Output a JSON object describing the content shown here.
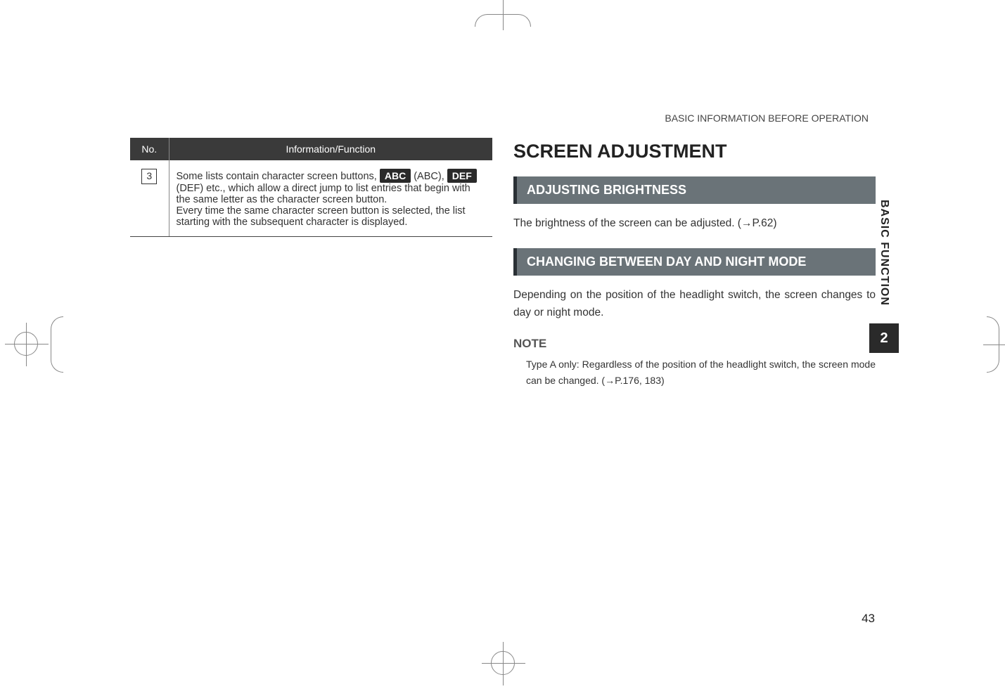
{
  "header": "BASIC INFORMATION BEFORE OPERATION",
  "table": {
    "col_no": "No.",
    "col_info": "Information/Function",
    "row_num": "3",
    "text_1": "Some lists contain character screen buttons, ",
    "btn_abc": "ABC",
    "text_2": " (ABC), ",
    "btn_def": "DEF",
    "text_3": " (DEF) etc., which allow a direct jump to list entries that begin with the same letter as the character screen button.",
    "text_4": "Every time the same character screen button is selected, the list starting with the subsequent character is displayed."
  },
  "right": {
    "title": "SCREEN ADJUSTMENT",
    "sec1": "ADJUSTING BRIGHTNESS",
    "sec1_body": "The brightness of the screen can be adjusted. (→P.62)",
    "sec2": "CHANGING BETWEEN DAY AND NIGHT MODE",
    "sec2_body": "Depending on the position of the headlight switch, the screen changes to day or night mode.",
    "note_head": "NOTE",
    "note_body": "Type A only: Regardless of the position of the headlight switch, the screen mode can be changed. (→P.176, 183)"
  },
  "sidebar": {
    "num": "2",
    "text": "BASIC FUNCTION"
  },
  "page_num": "43"
}
